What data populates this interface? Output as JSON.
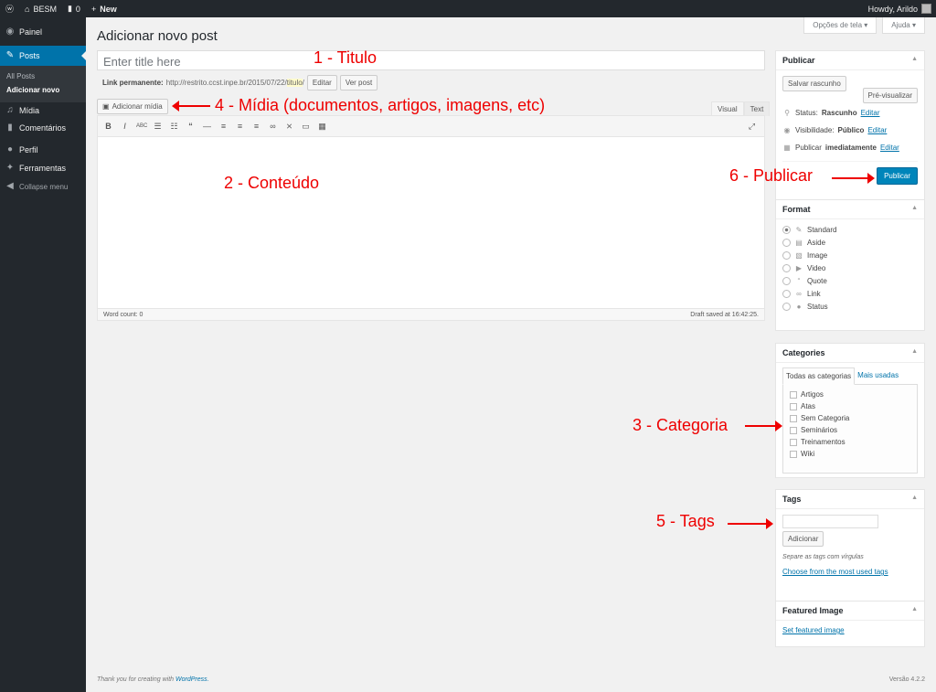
{
  "adminbar": {
    "site_name": "BESM",
    "comments_count": "0",
    "new_label": "New",
    "howdy": "Howdy, Arildo"
  },
  "sidebar": {
    "items": [
      {
        "label": "Painel",
        "icon": "dashboard-icon"
      },
      {
        "label": "Posts",
        "icon": "pin-icon"
      },
      {
        "label": "Mídia",
        "icon": "media-icon"
      },
      {
        "label": "Comentários",
        "icon": "comments-icon"
      },
      {
        "label": "Perfil",
        "icon": "user-icon"
      },
      {
        "label": "Ferramentas",
        "icon": "wrench-icon"
      },
      {
        "label": "Collapse menu",
        "icon": "collapse-icon"
      }
    ],
    "submenu": [
      "All Posts",
      "Adicionar novo"
    ]
  },
  "screen_options": "Opções de tela",
  "help": "Ajuda",
  "page_title": "Adicionar novo post",
  "title_placeholder": "Enter title here",
  "permalink": {
    "label": "Link permanente:",
    "url": "http://restrito.ccst.inpe.br/2015/07/22/",
    "slug": "titulo",
    "trail": "/",
    "edit": "Editar",
    "view": "Ver post"
  },
  "add_media": "Adicionar mídia",
  "editor_tabs": [
    "Visual",
    "Text"
  ],
  "word_count": "Word count: 0",
  "draft_saved": "Draft saved at 16:42:25.",
  "publish": {
    "title": "Publicar",
    "save_draft": "Salvar rascunho",
    "preview": "Pré-visualizar",
    "status_label": "Status:",
    "status_value": "Rascunho",
    "visibility_label": "Visibilidade:",
    "visibility_value": "Público",
    "publish_label": "Publicar",
    "publish_value": "imediatamente",
    "edit": "Editar",
    "button": "Publicar"
  },
  "format": {
    "title": "Format",
    "options": [
      "Standard",
      "Aside",
      "Image",
      "Video",
      "Quote",
      "Link",
      "Status"
    ],
    "selected": "Standard"
  },
  "categories": {
    "title": "Categories",
    "tab_all": "Todas as categorias",
    "tab_used": "Mais usadas",
    "items": [
      "Artigos",
      "Atas",
      "Sem Categoria",
      "Seminários",
      "Treinamentos",
      "Wiki"
    ]
  },
  "tags": {
    "title": "Tags",
    "add": "Adicionar",
    "hint": "Separe as tags com vírgulas",
    "choose": "Choose from the most used tags"
  },
  "featured": {
    "title": "Featured Image",
    "link": "Set featured image"
  },
  "footer": {
    "thanks": "Thank you for creating with",
    "wp": "WordPress.",
    "version": "Versão 4.2.2"
  },
  "annotations": {
    "titulo": "1 - Titulo",
    "conteudo": "2 - Conteúdo",
    "categoria": "3 - Categoria",
    "midia": "4 - Mídia (documentos, artigos, imagens, etc)",
    "tags": "5 - Tags",
    "publicar": "6 - Publicar"
  },
  "colors": {
    "adminbar": "#23282d",
    "active": "#0073aa",
    "publish_button": "#0085ba",
    "annotation": "#ee0000"
  }
}
